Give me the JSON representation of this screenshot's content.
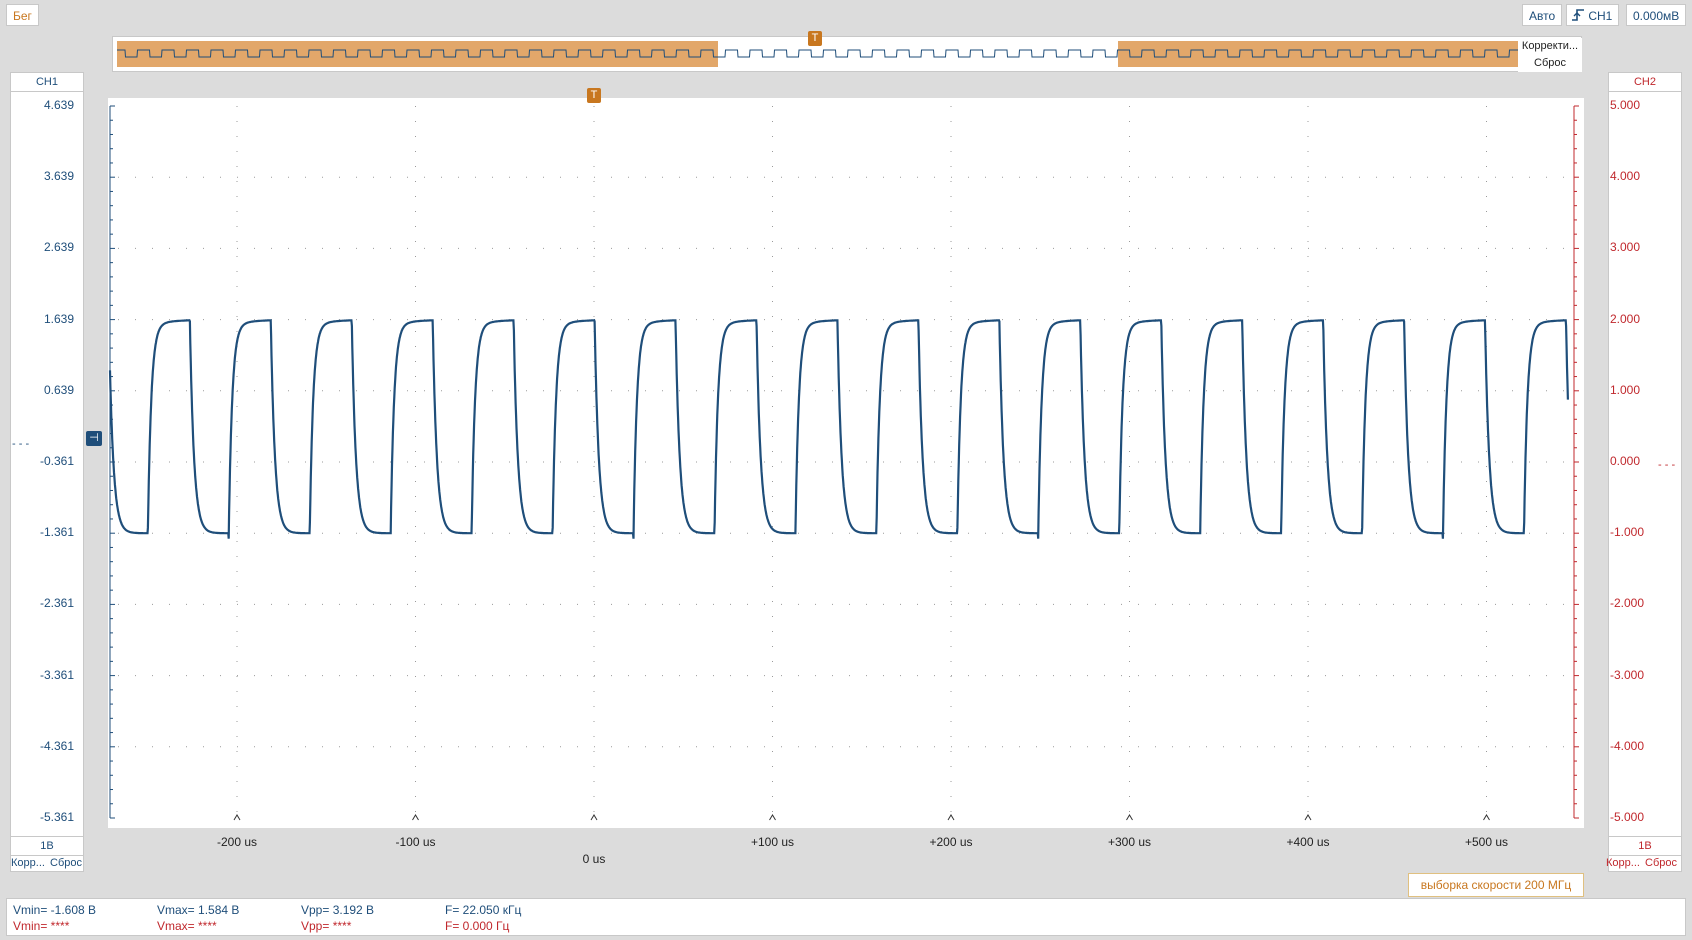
{
  "toolbar": {
    "run_label": "Бег",
    "mode_label": "Авто",
    "trigger_channel": "CH1",
    "trigger_level": "0.000мВ"
  },
  "overview": {
    "correct_label": "Корректи...",
    "reset_label": "Сброс",
    "trigger_marker": "T"
  },
  "ch1": {
    "name": "CH1",
    "ticks": [
      "4.639",
      "3.639",
      "2.639",
      "1.639",
      "0.639",
      "-0.361",
      "-1.361",
      "-2.361",
      "-3.361",
      "-4.361",
      "-5.361"
    ],
    "scale": "1В",
    "correct_label": "Корр...",
    "reset_label": "Сброс",
    "color": "#1f4e7a"
  },
  "ch2": {
    "name": "CH2",
    "ticks": [
      "5.000",
      "4.000",
      "3.000",
      "2.000",
      "1.000",
      "0.000",
      "-1.000",
      "-2.000",
      "-3.000",
      "-4.000",
      "-5.000"
    ],
    "scale": "1В",
    "correct_label": "Корр...",
    "reset_label": "Сброс",
    "color": "#c0282d"
  },
  "time_axis": {
    "ticks": [
      "-200 us",
      "-100 us",
      "+100 us",
      "+200 us",
      "+300 us",
      "+400 us",
      "+500 us"
    ],
    "zero_label": "0 us"
  },
  "trigger_marker": "T",
  "sample_rate": "выборка скорости 200 МГц",
  "measurements": {
    "ch1": {
      "vmin": "Vmin= -1.608 В",
      "vmax": "Vmax= 1.584 В",
      "vpp": "Vpp= 3.192 В",
      "freq": "F= 22.050 кГц"
    },
    "ch2": {
      "vmin": "Vmin= ****",
      "vmax": "Vmax= ****",
      "vpp": "Vpp= ****",
      "freq": "F= 0.000 Гц"
    }
  },
  "chart_data": {
    "type": "line",
    "series": [
      {
        "name": "CH1",
        "color": "#1f4e7a",
        "waveform": "square-ish with exponential edges",
        "low_v": -1.361,
        "high_v": 1.639,
        "period_us": 45.35
      }
    ],
    "xlim_us": [
      -270,
      550
    ],
    "ylim_ch1": [
      -5.361,
      4.639
    ],
    "ylim_ch2": [
      -5.0,
      5.0
    ],
    "grid": true
  }
}
